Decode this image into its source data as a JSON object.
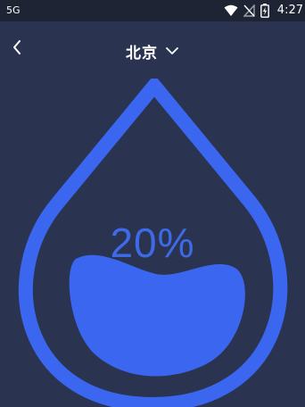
{
  "status_bar": {
    "network": "5G",
    "time": "4:27",
    "icons": [
      "wifi-icon",
      "no-sim-icon",
      "battery-charging-icon"
    ]
  },
  "header": {
    "back_icon": "chevron-left-icon",
    "city": "北京",
    "dropdown_icon": "chevron-down-icon"
  },
  "humidity": {
    "display": "20%",
    "fill_fraction": 0.2
  },
  "colors": {
    "background": "#2a3451",
    "status_bar": "#1e2433",
    "accent": "#3a66f0",
    "text": "#ffffff"
  }
}
